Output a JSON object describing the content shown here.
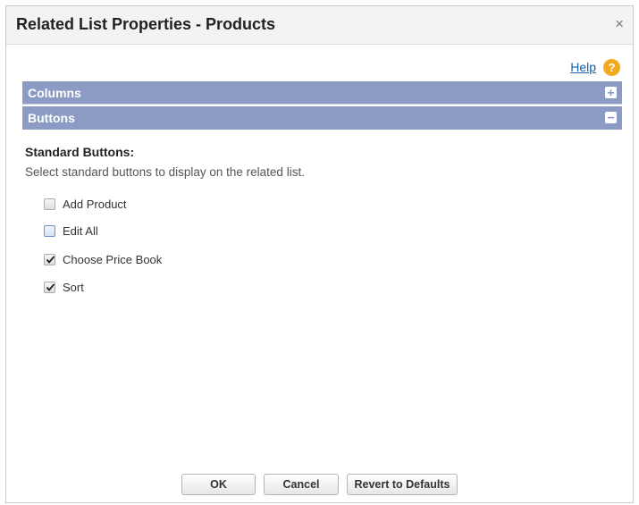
{
  "dialog": {
    "title": "Related List Properties - Products",
    "close_glyph": "×"
  },
  "help": {
    "label": "Help",
    "icon": "question-icon",
    "icon_glyph": "?"
  },
  "sections": {
    "columns": {
      "label": "Columns",
      "state": "collapsed",
      "toggle_icon": "plus-icon"
    },
    "buttons": {
      "label": "Buttons",
      "state": "expanded",
      "toggle_icon": "minus-icon"
    }
  },
  "standard_buttons": {
    "heading": "Standard Buttons:",
    "description": "Select standard buttons to display on the related list.",
    "options": [
      {
        "label": "Add Product",
        "checked": false
      },
      {
        "label": "Edit All",
        "checked": false
      },
      {
        "label": "Choose Price Book",
        "checked": true
      },
      {
        "label": "Sort",
        "checked": true
      }
    ]
  },
  "footer": {
    "ok_label": "OK",
    "cancel_label": "Cancel",
    "revert_label": "Revert to Defaults"
  },
  "colors": {
    "section_bar": "#8b9bc4",
    "help_link": "#1a5ea8",
    "help_icon": "#f2a91f"
  }
}
